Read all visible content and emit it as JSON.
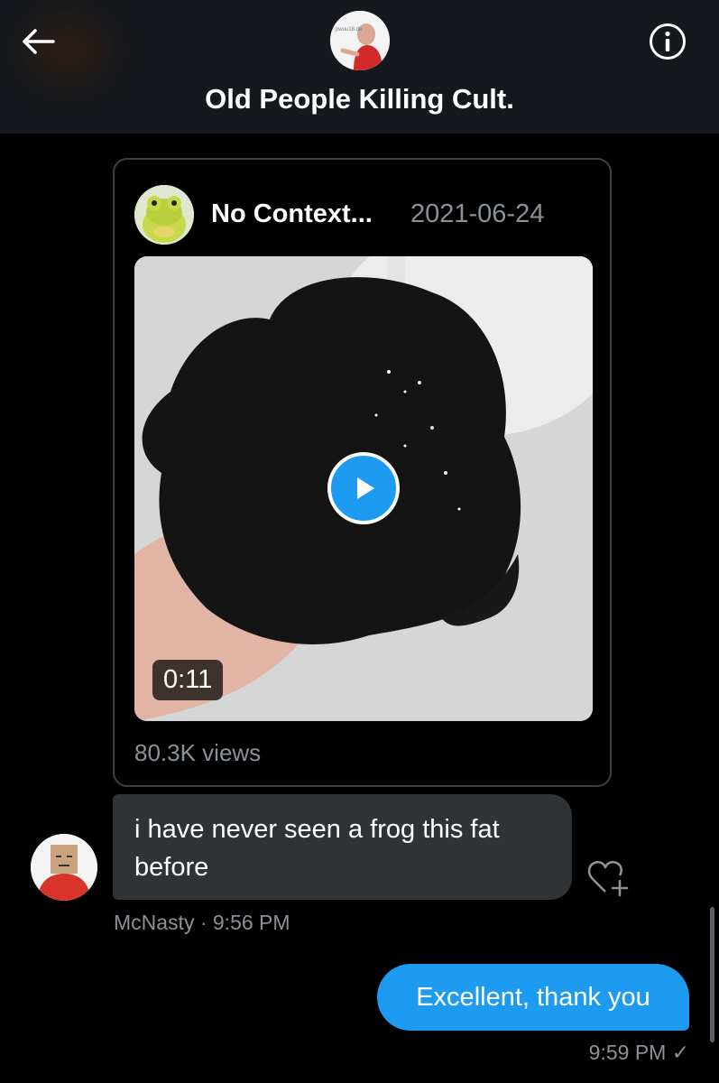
{
  "header": {
    "title": "Old People Killing Cult.",
    "back_icon": "arrow-left-icon",
    "info_icon": "info-circle-icon",
    "avatar_text": "pwuu18.de"
  },
  "shared_tweet": {
    "author": "No Context...",
    "date": "2021-06-24",
    "video_duration": "0:11",
    "views": "80.3K views",
    "play_icon": "play-icon"
  },
  "messages": {
    "incoming": {
      "text": "i have never seen a frog this fat before",
      "meta": "McNasty · 9:56 PM",
      "react_icon": "heart-plus-icon"
    },
    "outgoing": {
      "text": "Excellent, thank you",
      "meta": "9:59 PM ✓"
    }
  },
  "colors": {
    "accent": "#1d9bf0",
    "incoming_bubble": "#2f3336",
    "header_bg": "#15181c",
    "muted_text": "#8b9196"
  }
}
